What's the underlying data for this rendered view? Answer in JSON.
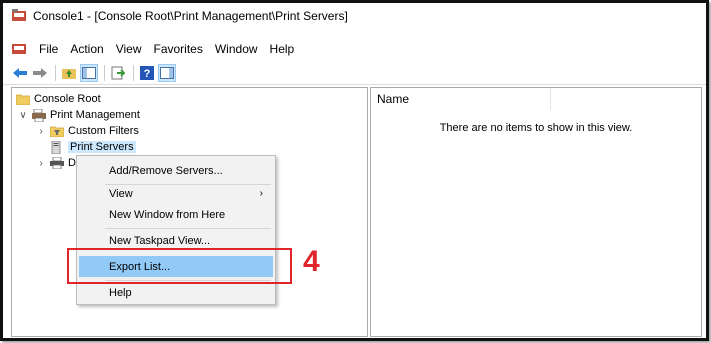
{
  "window": {
    "title": "Console1 - [Console Root\\Print Management\\Print Servers]"
  },
  "menubar": {
    "items": [
      "File",
      "Action",
      "View",
      "Favorites",
      "Window",
      "Help"
    ]
  },
  "toolbar": {
    "buttons": [
      "back-icon",
      "forward-icon",
      "up-folder-icon",
      "show-hide-tree-icon",
      "export-list-icon",
      "help-icon",
      "show-action-pane-icon"
    ]
  },
  "tree": {
    "root": "Console Root",
    "print_management": "Print Management",
    "custom_filters": "Custom Filters",
    "print_servers": "Print Servers",
    "deployed_truncated": "D"
  },
  "list": {
    "column_name": "Name",
    "empty_message": "There are no items to show in this view."
  },
  "context_menu": {
    "add_remove_servers": "Add/Remove Servers...",
    "view": "View",
    "new_window": "New Window from Here",
    "new_taskpad": "New Taskpad View...",
    "export_list": "Export List...",
    "help": "Help"
  },
  "annotation": {
    "step_number": "4"
  },
  "colors": {
    "selection": "#cce8ff",
    "menu_highlight": "#91c9f7",
    "callout_red": "#e0252d"
  }
}
